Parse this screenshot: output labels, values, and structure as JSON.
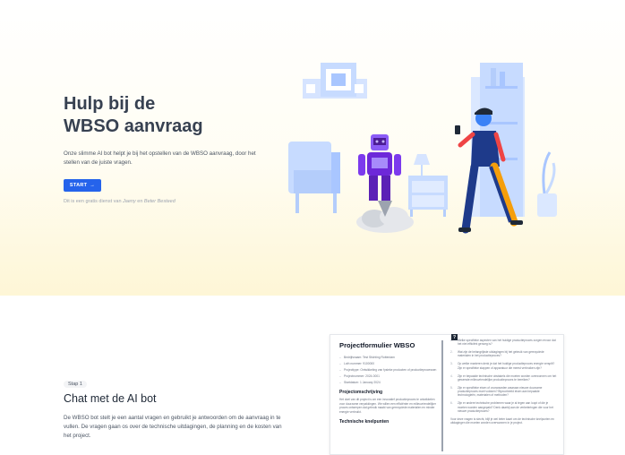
{
  "hero": {
    "title_line1": "Hulp bij de",
    "title_line2": "WBSO aanvraag",
    "description": "Onze slimme AI bot helpt je bij het opstellen van de WBSO aanvraag, door het stellen van de juiste vragen.",
    "start_label": "START",
    "start_arrow": "→",
    "credit_prefix": "Dit is een gratis dienst van",
    "credit_name1": "Jaeny",
    "credit_and": "en",
    "credit_name2": "Beter Besteed"
  },
  "step": {
    "badge": "Stap 1",
    "title": "Chat met de AI bot",
    "description": "De WBSO bot stelt je een aantal vragen en gebruikt je antwoorden om de aanvraag in te vullen. De vragen gaan os over de technische uitdagingen, de planning en de kosten van het project."
  },
  "doc": {
    "title": "Projectformulier WBSO",
    "info": [
      "Bedrijfsnaam: Test Stichting Rotterdam",
      "Loth nummer: 9100000",
      "Projecttype: Ontwikkeling van fysieke producten of productieprocessen",
      "Projectnummer: 2024-0001",
      "Startdatum: 1 January 2024"
    ],
    "section1_heading": "Projectomschrijving",
    "section1_text": "Het doel van dit project is om een innovatief productieproces te ontwikkelen voor duurzame verpakkingen. We willen een efficiënter en milieuvriendelijker proces ontwerpen dat gebruik maakt van gerecyclede materialen en minder energie verbruikt.",
    "section2_heading": "Technische knelpunten",
    "question_icon": "?",
    "questions": [
      {
        "n": "1.",
        "text": "Welke specifieke aspecten van het huidige productieproces zorgen ervoor dat het niet efficiënt genoeg is?"
      },
      {
        "n": "2.",
        "text": "Wat zijn de belangrijkste uitdagingen bij het gebruik van gerecyclede materialen in het productieproces?"
      },
      {
        "n": "3.",
        "text": "Op welke manieren denk je dat het huidige productieproces energie verspilt? Zijn er specifieke stappen of apparatuur die meest verbruiken zijn?"
      },
      {
        "n": "4.",
        "text": "Zijn er bepaalde technische obstakels die moeten worden overwonnen om het gewenste milieuvriendelijke productieproces te bereiken?"
      },
      {
        "n": "5.",
        "text": "Zijn er specifieke eisen of voorwaarden waaraan nieuwe duurzame productieproces moet voldoen? Bijvoorbeeld eisen aan bepaalde technologieën, materialen of methoden?"
      },
      {
        "n": "6.",
        "text": "Zijn er andere technische problemen waar je al tegen aan loopt of die je moeten worden aangepakt? Denk daarbij aan de verbeteringen die voor het nieuwe productieproces?"
      }
    ],
    "footer": "Voor deze vragen is slecht, blijf je wel beter kaart om de technische knelpunten en uitdagingen die moeten worden overwonnen in je project."
  }
}
